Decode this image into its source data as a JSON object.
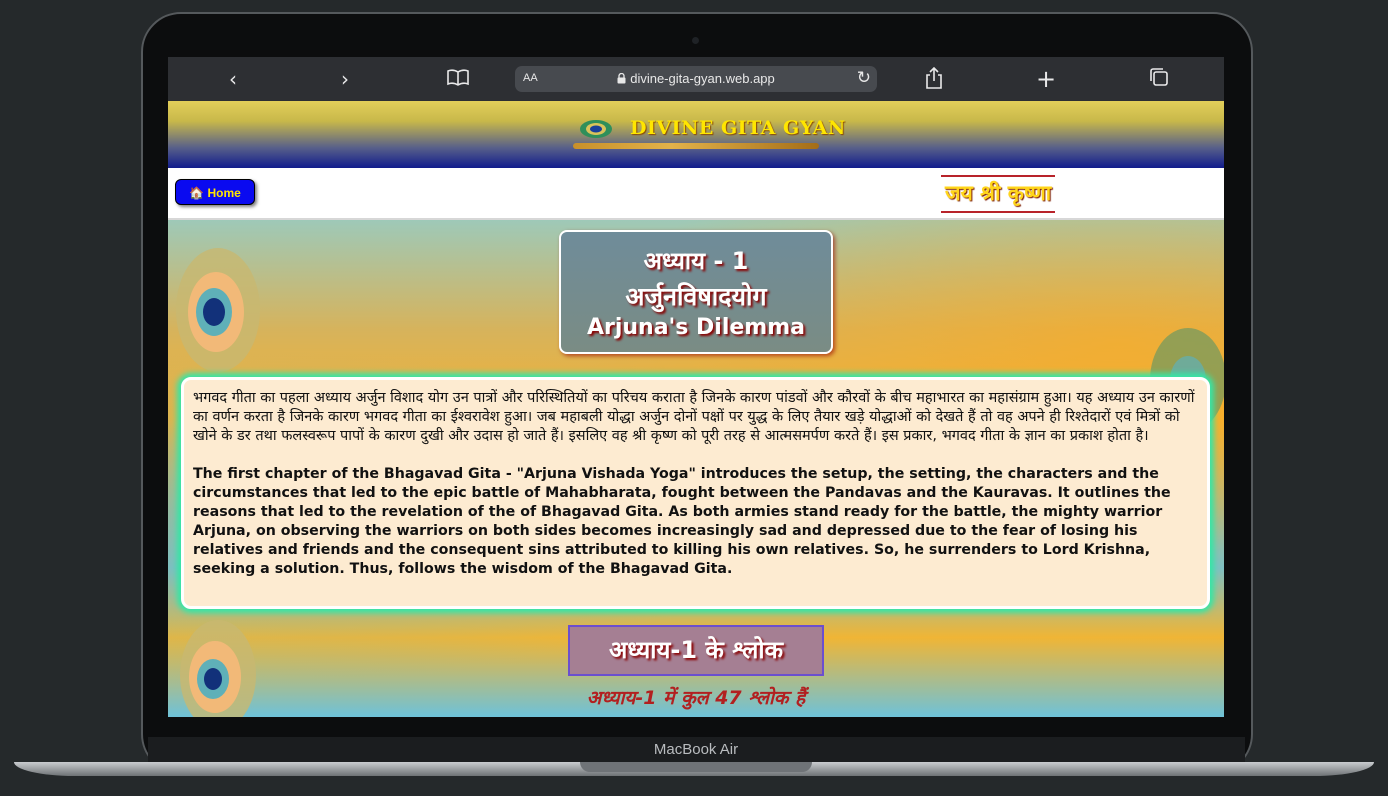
{
  "device": {
    "model_label": "MacBook Air"
  },
  "browser": {
    "aa_label": "AA",
    "url": "divine-gita-gyan.web.app",
    "lock_icon": "lock-icon",
    "icons": [
      "back-icon",
      "forward-icon",
      "book-icon",
      "reload-icon",
      "share-icon",
      "plus-icon",
      "tabs-icon"
    ]
  },
  "site": {
    "banner_title": "DIVINE GITA GYAN",
    "home_label": "Home",
    "home_icon": "🏠",
    "greeting": "जय श्री कृष्णा"
  },
  "chapter": {
    "number": "अध्याय - 1",
    "title_hindi": "अर्जुनविषादयोग",
    "title_english": "Arjuna's Dilemma",
    "description_hindi": "भगवद गीता का पहला अध्याय अर्जुन विशाद योग उन पात्रों और परिस्थितियों का परिचय कराता है जिनके कारण पांडवों और कौरवों के बीच महाभारत का महासंग्राम हुआ। यह अध्याय उन कारणों का वर्णन करता है जिनके कारण भगवद गीता का ईश्वरावेश हुआ। जब महाबली योद्धा अर्जुन दोनों पक्षों पर युद्ध के लिए तैयार खड़े योद्धाओं को देखते हैं तो वह अपने ही रिश्तेदारों एवं मित्रों को खोने के डर तथा फलस्वरूप पापों के कारण दुखी और उदास हो जाते हैं। इसलिए वह श्री कृष्ण को पूरी तरह से आत्मसमर्पण करते हैं। इस प्रकार, भगवद गीता के ज्ञान का प्रकाश होता है।",
    "description_english": "The first chapter of the Bhagavad Gita - \"Arjuna Vishada Yoga\" introduces the setup, the setting, the characters and the circumstances that led to the epic battle of Mahabharata, fought between the Pandavas and the Kauravas. It outlines the reasons that led to the revelation of the of Bhagavad Gita. As both armies stand ready for the battle, the mighty warrior Arjuna, on observing the warriors on both sides becomes increasingly sad and depressed due to the fear of losing his relatives and friends and the consequent sins attributed to killing his own relatives. So, he surrenders to Lord Krishna, seeking a solution. Thus, follows the wisdom of the Bhagavad Gita.",
    "shlok_heading": "अध्याय-1 के श्लोक",
    "total_shloks": "अध्याय-1 में कुल 47 श्लोक हैं"
  },
  "colors": {
    "accent": "#ffe600",
    "home_button": "#0a0af0",
    "desc_glow": "#35e6a6"
  }
}
